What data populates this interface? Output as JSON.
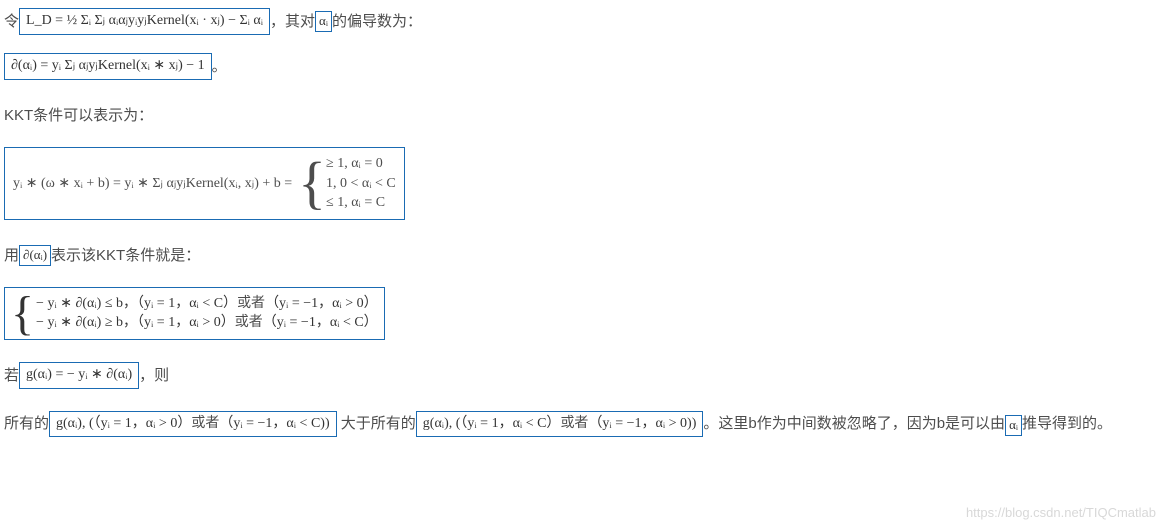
{
  "line1": {
    "pre": "令",
    "eq": "L_D = ½ Σᵢ Σⱼ αᵢαⱼyᵢyⱼKernel(xᵢ · xⱼ) − Σᵢ αᵢ",
    "mid": "，其对",
    "var": "αᵢ",
    "post": "的偏导数为："
  },
  "line2": {
    "eq": "∂(αᵢ) = yᵢ Σⱼ αⱼyⱼKernel(xᵢ ∗ xⱼ) − 1",
    "post": "。"
  },
  "line3": {
    "text": "KKT条件可以表示为："
  },
  "kkt": {
    "lhs": "yᵢ ∗ (ω ∗ xᵢ + b) =  yᵢ ∗ Σⱼ αⱼyⱼKernel(xᵢ, xⱼ) + b =",
    "c1": "≥ 1, αᵢ = 0",
    "c2": "1, 0 < αᵢ < C",
    "c3": "≤ 1, αᵢ = C"
  },
  "line5": {
    "pre": "用",
    "eq": "∂(αᵢ)",
    "post": "表示该KKT条件就是："
  },
  "kkt2": {
    "r1a": "− yᵢ ∗ ∂(αᵢ) ≤ b，（yᵢ = 1，αᵢ < C）",
    "r1b": "或者",
    "r1c": "（yᵢ = −1，αᵢ > 0）",
    "r2a": "− yᵢ ∗ ∂(αᵢ) ≥ b，（yᵢ = 1，αᵢ > 0）",
    "r2b": "或者",
    "r2c": "（yᵢ = −1，αᵢ < C）"
  },
  "line7": {
    "pre": "若",
    "eq": "g(αᵢ) = − yᵢ ∗ ∂(αᵢ)",
    "post": "，则"
  },
  "final": {
    "t1": "所有的",
    "eq1a": "g(αᵢ), (（yᵢ = 1，αᵢ > 0）",
    "eq1b": "或者",
    "eq1c": "（yᵢ = −1，αᵢ < C))",
    "t2": " 大于所有的",
    "eq2a": "g(αᵢ), (（yᵢ = 1，αᵢ < C）",
    "eq2b": "或者",
    "eq2c": "（yᵢ = −1，αᵢ > 0))",
    "t3": "。这里b作为中间数被忽略了，因为b是可以由",
    "var": "αᵢ",
    "t4": "推导得到的。"
  },
  "watermark": "https://blog.csdn.net/TIQCmatlab"
}
